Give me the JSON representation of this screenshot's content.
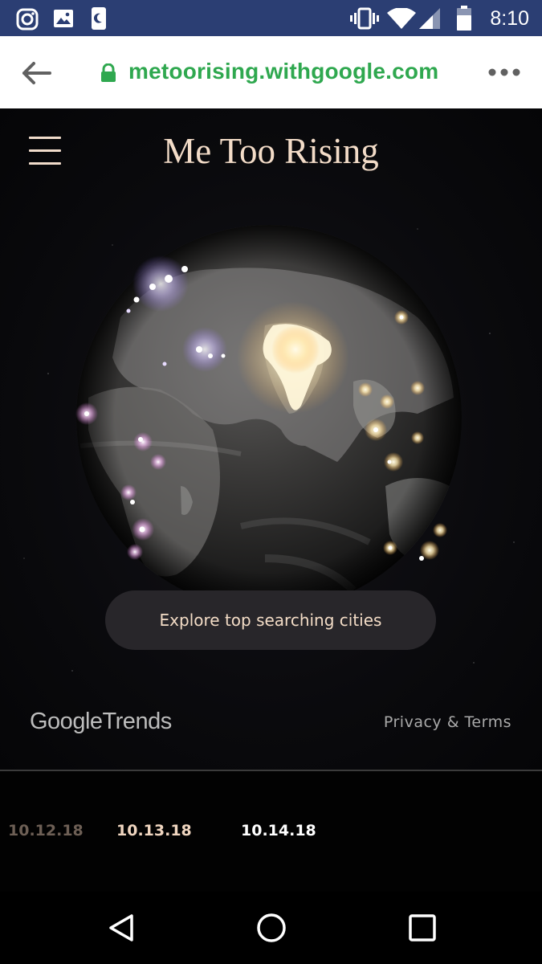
{
  "status_bar": {
    "time": "8:10",
    "icons": [
      "instagram-icon",
      "image-icon",
      "do-not-disturb-icon",
      "vibrate-icon",
      "wifi-icon",
      "cell-signal-icon",
      "battery-icon"
    ]
  },
  "browser": {
    "url": "metoorising.withgoogle.com",
    "url_color": "#2fa84f"
  },
  "app": {
    "title": "Me Too Rising",
    "explore_button": "Explore top searching cities",
    "google_brand": "Google",
    "trends_brand": "Trends",
    "privacy_link": "Privacy & Terms",
    "accent": "#f3dcc8"
  },
  "timeline": {
    "dates": [
      "10.12.18",
      "10.13.18",
      "10.14.18"
    ]
  },
  "navbar": {
    "icons": [
      "back-triangle-icon",
      "home-circle-icon",
      "recents-square-icon"
    ]
  }
}
